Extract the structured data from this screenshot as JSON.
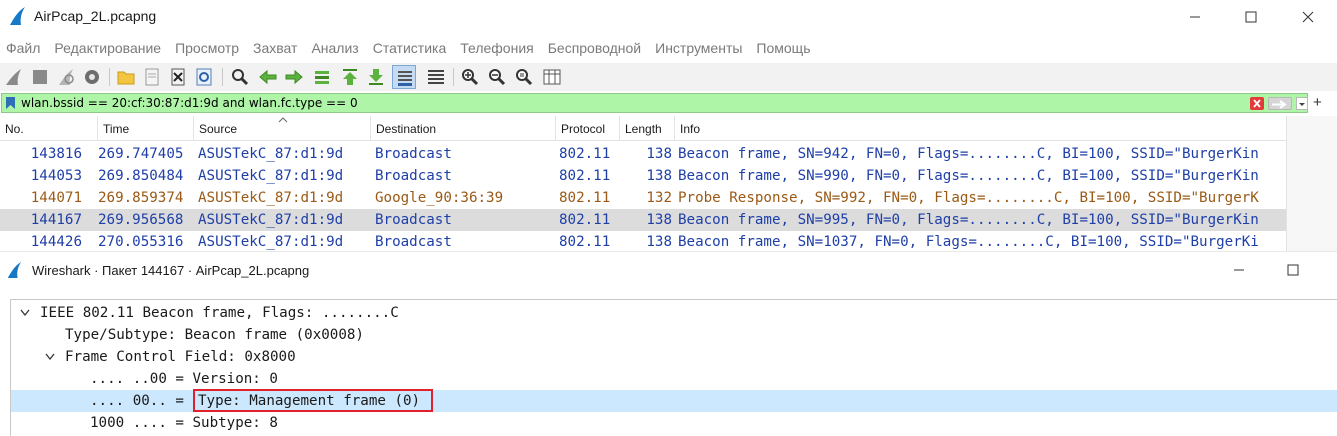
{
  "window": {
    "title": "AirPcap_2L.pcapng"
  },
  "menu": [
    "Файл",
    "Редактирование",
    "Просмотр",
    "Захват",
    "Анализ",
    "Статистика",
    "Телефония",
    "Беспроводной",
    "Инструменты",
    "Помощь"
  ],
  "toolbar": {
    "icons": [
      "start-capture-icon",
      "stop-capture-icon",
      "restart-capture-icon",
      "capture-options-icon",
      "open-file-icon",
      "save-file-icon",
      "close-file-icon",
      "reload-file-icon",
      "find-packet-icon",
      "go-back-icon",
      "go-forward-icon",
      "go-to-packet-icon",
      "go-first-icon",
      "go-last-icon",
      "autoscroll-icon",
      "colorize-icon",
      "zoom-in-icon",
      "zoom-out-icon",
      "zoom-normal-icon",
      "resize-columns-icon"
    ]
  },
  "filter": {
    "value": "wlan.bssid == 20:cf:30:87:d1:9d and wlan.fc.type == 0",
    "bg_color": "#aff5a8"
  },
  "packet_list": {
    "columns": [
      "No.",
      "Time",
      "Source",
      "Destination",
      "Protocol",
      "Length",
      "Info"
    ],
    "rows": [
      {
        "no": "143816",
        "time": "269.747405",
        "source": "ASUSTekC_87:d1:9d",
        "destination": "Broadcast",
        "protocol": "802.11",
        "length": "138",
        "info": "Beacon frame, SN=942, FN=0, Flags=........C, BI=100, SSID=\"BurgerKin",
        "color": "#1f3fa8",
        "selected": false
      },
      {
        "no": "144053",
        "time": "269.850484",
        "source": "ASUSTekC_87:d1:9d",
        "destination": "Broadcast",
        "protocol": "802.11",
        "length": "138",
        "info": "Beacon frame, SN=990, FN=0, Flags=........C, BI=100, SSID=\"BurgerKin",
        "color": "#1f3fa8",
        "selected": false
      },
      {
        "no": "144071",
        "time": "269.859374",
        "source": "ASUSTekC_87:d1:9d",
        "destination": "Google_90:36:39",
        "protocol": "802.11",
        "length": "132",
        "info": "Probe Response, SN=992, FN=0, Flags=........C, BI=100, SSID=\"BurgerK",
        "color": "#9a5a16",
        "selected": false
      },
      {
        "no": "144167",
        "time": "269.956568",
        "source": "ASUSTekC_87:d1:9d",
        "destination": "Broadcast",
        "protocol": "802.11",
        "length": "138",
        "info": "Beacon frame, SN=995, FN=0, Flags=........C, BI=100, SSID=\"BurgerKin",
        "color": "#1f3fa8",
        "selected": true
      },
      {
        "no": "144426",
        "time": "270.055316",
        "source": "ASUSTekC_87:d1:9d",
        "destination": "Broadcast",
        "protocol": "802.11",
        "length": "138",
        "info": "Beacon frame, SN=1037, FN=0, Flags=........C, BI=100, SSID=\"BurgerKi",
        "color": "#1f3fa8",
        "selected": false
      }
    ]
  },
  "dialog": {
    "title": "Wireshark · Пакет 144167 · AirPcap_2L.pcapng"
  },
  "details": {
    "rows": [
      {
        "text": "IEEE 802.11 Beacon frame, Flags: ........C",
        "expanded": true
      },
      {
        "text": "Type/Subtype: Beacon frame (0x0008)"
      },
      {
        "text": "Frame Control Field: 0x8000",
        "expanded": true
      },
      {
        "text": ".... ..00 = Version: 0"
      },
      {
        "prefix": ".... 00.. = ",
        "highlight": "Type: Management frame (0)",
        "selected": true
      },
      {
        "text": "1000 .... = Subtype: 8"
      }
    ]
  }
}
